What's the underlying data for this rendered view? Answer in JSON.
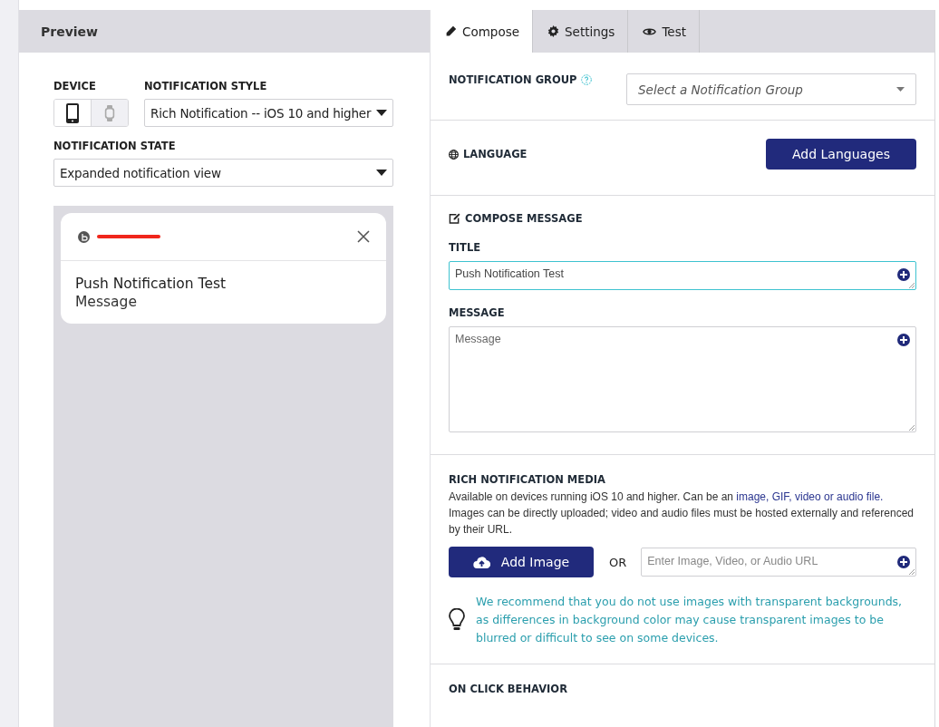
{
  "preview": {
    "title": "Preview",
    "device": {
      "label": "DEVICE",
      "options": [
        {
          "kind": "phone",
          "selected": true
        },
        {
          "kind": "watch",
          "selected": false
        }
      ]
    },
    "notification_style": {
      "label": "NOTIFICATION STYLE",
      "value": "Rich Notification -- iOS 10 and higher"
    },
    "notification_state": {
      "label": "NOTIFICATION STATE",
      "value": "Expanded notification view"
    },
    "notification": {
      "title": "Push Notification Test",
      "message": "Message"
    }
  },
  "tabs": [
    {
      "label": "Compose",
      "kind": "pencil",
      "selected": true
    },
    {
      "label": "Settings",
      "kind": "gear",
      "selected": false
    },
    {
      "label": "Test",
      "kind": "eye",
      "selected": false
    }
  ],
  "notification_group": {
    "label": "NOTIFICATION GROUP",
    "placeholder": "Select a Notification Group"
  },
  "language": {
    "label": "LANGUAGE",
    "button": "Add Languages"
  },
  "compose_message": {
    "heading": "COMPOSE MESSAGE",
    "fields": [
      {
        "label": "TITLE",
        "value": "Push Notification Test",
        "focused": true,
        "kind": "input"
      },
      {
        "label": "MESSAGE",
        "placeholder": "Message",
        "focused": false,
        "kind": "textarea"
      }
    ]
  },
  "rich_media": {
    "heading": "RICH NOTIFICATION MEDIA",
    "description_before": "Available on devices running iOS 10 and higher. Can be an ",
    "description_link": "image, GIF, video or audio file.",
    "description_after": " Images can be directly uploaded; video and audio files must be hosted externally and referenced by their URL.",
    "button": "Add Image",
    "or": "OR",
    "url_placeholder": "Enter Image, Video, or Audio URL",
    "tip": "We recommend that you do not use images with transparent backgrounds, as differences in background color may cause transparent images to be blurred or difficult to see on some devices."
  },
  "on_click": {
    "heading": "ON CLICK BEHAVIOR"
  }
}
